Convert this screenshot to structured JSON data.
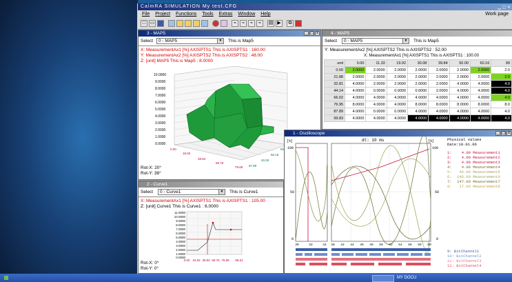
{
  "app": {
    "title": "CalmRA SIMULATION   My test.CFG",
    "menu": [
      "File",
      "Project",
      "Functions",
      "Tools",
      "Extras",
      "Window",
      "Help"
    ],
    "workpage": "Work page"
  },
  "map_window": {
    "title": "3 - MAP5",
    "select_label": "Select",
    "select_value": "0 - MAP5",
    "select_desc": "This is Map5",
    "line_x": "X: MeasurementAx1 [%] AXISPTS1 This is AXISPTS1 : 160.00",
    "line_y": "Y: MeasurementAx2 [%] AXISPTS2 This is AXISPTS2 : 48.00",
    "line_z": "Z: [unit] MAP5 This is Map5 : 8.0000",
    "z_ticks": [
      "10.0000",
      "9.0000",
      "8.0000",
      "7.0000",
      "6.0000",
      "5.0000",
      "4.0000",
      "3.0000",
      "2.0000",
      "1.0000",
      "0.0000"
    ],
    "x_ticks": [
      "0.00",
      "19.92",
      "39.84",
      "59.76",
      "79.68"
    ],
    "y_ticks": [
      "120.00",
      "80.00",
      "66.18",
      "40.00",
      "87.89"
    ],
    "rot_x": "Rot-X: 20°",
    "rot_y": "Rot-Y: 38°"
  },
  "table_window": {
    "title": "4 - MAP5",
    "select_label": "Select",
    "select_value": "0 - MAP5",
    "select_desc": "This is Map5",
    "line_y": "Y: MeasurementAx2 [%] AXISPTS2 This is AXISPTS2 : 52.00",
    "line_x": "X: MeasurementAx1 [%] AXISPTS1 This is AXISPTS1 : 100.00",
    "unit_label": "unit",
    "col_headers": [
      "0.00",
      "11.33",
      "19.92",
      "30.08",
      "39.84",
      "50.00",
      "60.16",
      "99"
    ],
    "row_headers": [
      "0.00",
      "21.88",
      "32.81",
      "44.14",
      "66.02",
      "76.95",
      "87.89",
      "99.83"
    ],
    "rows": [
      [
        "2.0000",
        "2.0000",
        "2.0000",
        "2.0000",
        "2.0000",
        "2.0000",
        "2.0000",
        "2.0"
      ],
      [
        "2.0000",
        "2.0000",
        "2.0000",
        "2.0000",
        "2.0000",
        "2.0000",
        "2.0000",
        "2.0"
      ],
      [
        "4.0000",
        "2.0000",
        "2.0000",
        "2.0000",
        "2.0000",
        "4.0000",
        "4.0000",
        "4.0"
      ],
      [
        "4.0000",
        "0.0000",
        "0.0000",
        "0.0000",
        "2.0000",
        "4.0000",
        "4.0000",
        "4.0"
      ],
      [
        "4.0000",
        "4.0000",
        "4.0000",
        "4.0000",
        "4.0000",
        "4.0000",
        "4.0000",
        "4.0"
      ],
      [
        "8.0000",
        "4.0000",
        "4.0000",
        "8.0000",
        "8.0000",
        "8.0000",
        "8.0000",
        "8.0"
      ],
      [
        "4.0000",
        "0.0000",
        "0.0000",
        "4.0000",
        "4.0000",
        "4.0000",
        "4.0000",
        "4.0"
      ],
      [
        "4.0000",
        "4.0000",
        "4.0000",
        "4.0000",
        "4.0000",
        "4.0000",
        "4.0000",
        "4.0"
      ]
    ]
  },
  "curve_window": {
    "title": "2 - Curve1",
    "select_label": "Select",
    "select_value": "0 - Curve1",
    "select_desc": "This is Curve1",
    "line_x": "X: MeasurementAx1 [%] AXISPTS1 This is AXISPTS1 : 105.00",
    "line_z": "Z: [unit] Curve1 This is Curve1 : 6.0000",
    "y_ticks": [
      "11.0000",
      "10.0000",
      "9.0000",
      "8.0000",
      "7.0000",
      "6.0000",
      "5.0000",
      "4.0000",
      "3.0000",
      "2.0000",
      "1.0000",
      "0.0000"
    ],
    "x_ticks": [
      "0.00",
      "19.92",
      "39.84",
      "59.76",
      "79.68",
      "99.61"
    ],
    "rot_x": "Rot-X: 0°",
    "rot_y": "Rot-Y: 0°"
  },
  "oscilloscope": {
    "title": "1 - Oscilloscope",
    "dt_label": "dt: 10 ms",
    "y_unit_left": "[%]",
    "y_unit_right": "[%]",
    "y_top": "100",
    "y_mid": "50",
    "y_bottom": "0",
    "x_ticks_left": [
      "30",
      "32",
      "34"
    ],
    "x_ticks_right": [
      "40",
      "42",
      "44",
      "46",
      "48",
      "50",
      "52",
      "54",
      "56",
      "58",
      "60"
    ],
    "physical_label": "Physical values",
    "date_label": "Date:10.01.06",
    "values": [
      {
        "n": "1:",
        "v": "4.00",
        "name": "Measurement1"
      },
      {
        "n": "2:",
        "v": "4.00",
        "name": "Measurement2"
      },
      {
        "n": "3:",
        "v": "4.00",
        "name": "Measurement3"
      },
      {
        "n": "4:",
        "v": "4.00",
        "name": "Measurement4"
      },
      {
        "n": "5:",
        "v": "46.00",
        "name": "Measurement5"
      },
      {
        "n": "6:",
        "v": "146.00",
        "name": "Measurement6"
      },
      {
        "n": "7:",
        "v": "147.00",
        "name": "Measurement7"
      },
      {
        "n": "8:",
        "v": "17.00",
        "name": "Measurement8"
      }
    ],
    "bits": [
      {
        "n": "9:",
        "name": "BitChannel1"
      },
      {
        "n": "10:",
        "name": "BitChannel2"
      },
      {
        "n": "11:",
        "name": "BitChannel3"
      },
      {
        "n": "12:",
        "name": "BitChannel4"
      }
    ]
  },
  "taskbar": {
    "label": "",
    "right": "MY DOCU"
  }
}
